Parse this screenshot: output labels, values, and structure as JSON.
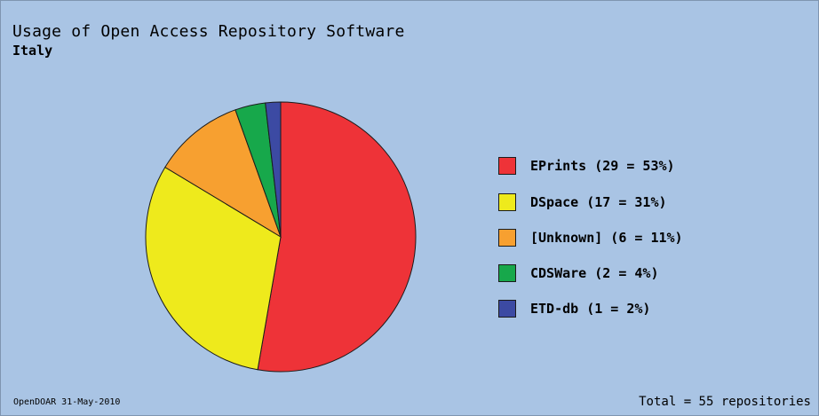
{
  "chart_data": {
    "type": "pie",
    "title": "Usage of Open Access Repository Software",
    "subtitle": "Italy",
    "slices": [
      {
        "name": "EPrints",
        "value": 29,
        "percent": 53,
        "color": "#ee3338",
        "legend": "EPrints (29 = 53%)"
      },
      {
        "name": "DSpace",
        "value": 17,
        "percent": 31,
        "color": "#eeea1c",
        "legend": "DSpace (17 = 31%)"
      },
      {
        "name": "[Unknown]",
        "value": 6,
        "percent": 11,
        "color": "#f7a030",
        "legend": "[Unknown] (6 = 11%)"
      },
      {
        "name": "CDSWare",
        "value": 2,
        "percent": 4,
        "color": "#17a84b",
        "legend": "CDSWare (2 = 4%)"
      },
      {
        "name": "ETD-db",
        "value": 1,
        "percent": 2,
        "color": "#3c4aa3",
        "legend": "ETD-db (1 = 2%)"
      }
    ],
    "legend_position": "right"
  },
  "footer": {
    "source": "OpenDOAR 31-May-2010",
    "total": "Total = 55 repositories"
  },
  "colors": {
    "background": "#a9c4e4",
    "outline": "#1b1b1b"
  }
}
